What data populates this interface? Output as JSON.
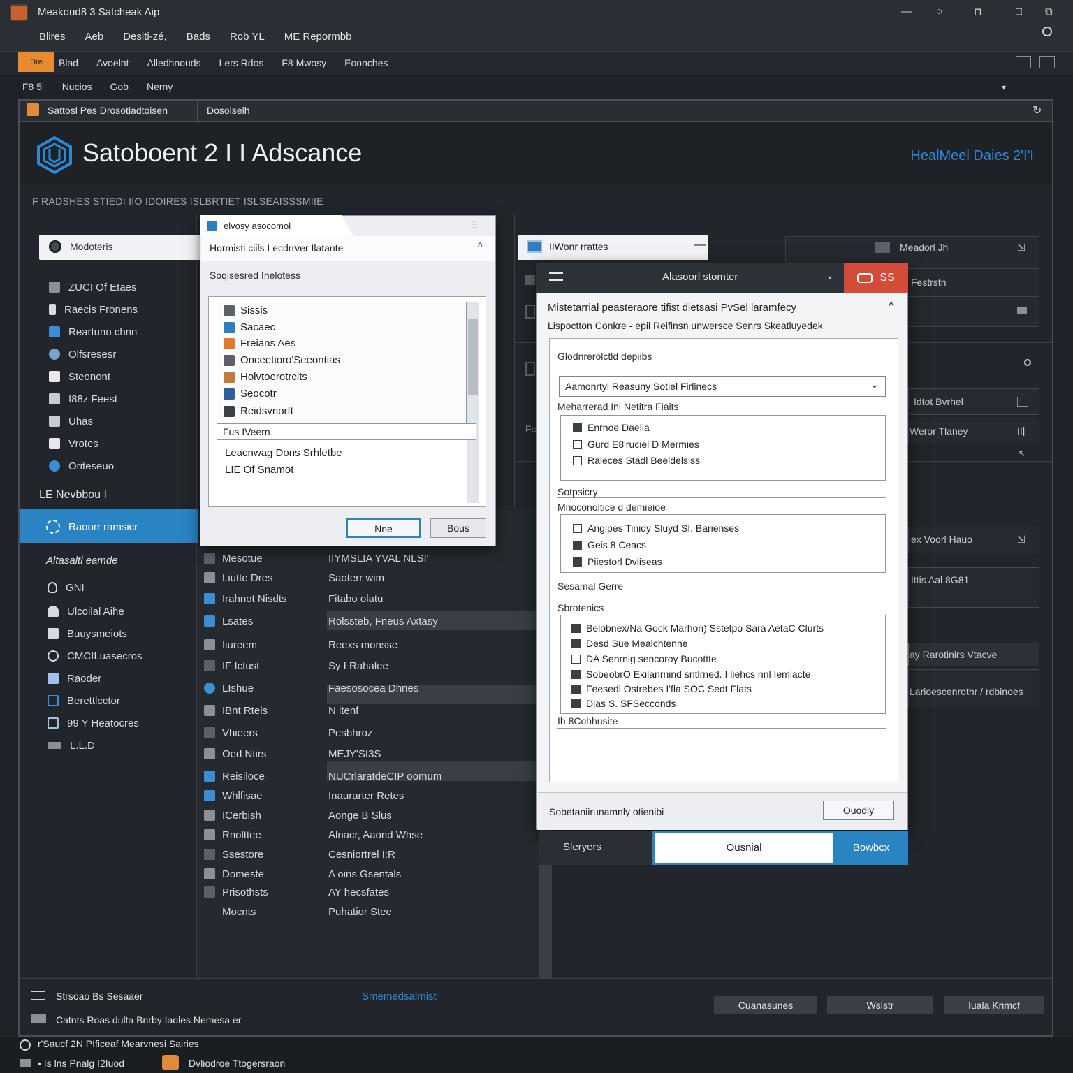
{
  "window": {
    "title": "Meakoud8 3 Satcheak Aip",
    "controls": [
      "—",
      "○",
      "⊓",
      "□",
      "⧉"
    ]
  },
  "menu": [
    "Blires",
    "Aeb",
    "Desiti-zé,",
    "Bads",
    "Rob YL",
    "ME Repormbb"
  ],
  "toolbar": {
    "badge": "Dre",
    "items": [
      "Blad",
      "Avoelnt",
      "Alledhnouds",
      "Lers Rdos",
      "F8 Mwosy",
      "Eoonches"
    ]
  },
  "tabs2": [
    "F8 5'",
    "Nucios",
    "Gob",
    "Nerny"
  ],
  "doc_tabs": [
    "Sattosl Pes Drosotiadtoisen",
    "Dosoiselh"
  ],
  "header": {
    "title": "Satoboent 2 I I Adscance",
    "accent": "HealMeel Daies 2'I'I",
    "subhead": "F RADSHES STIEDI   IIO IDOIRES   ISLBRTIET ISLSEAISSSMIIE"
  },
  "sidebar": {
    "search_label": "Modoteris",
    "items": [
      {
        "label": "ZUCI Of Etaes",
        "icon": "database-icon",
        "color": "#8b9098"
      },
      {
        "label": "Raecis Fronens",
        "icon": "pointer-icon",
        "color": "#d6dae0"
      },
      {
        "label": "Reartuno chnn",
        "icon": "chart-icon",
        "color": "#3a8ed4"
      },
      {
        "label": "Olfsresesr",
        "icon": "globe-icon",
        "color": "#7aa3c9"
      },
      {
        "label": "Steonont",
        "icon": "document-icon",
        "color": "#e6e8eb"
      },
      {
        "label": "I88z Feest",
        "icon": "image-icon",
        "color": "#c8ccd2"
      },
      {
        "label": "Uhas",
        "icon": "chart-bar-icon",
        "color": "#c8ccd2"
      },
      {
        "label": "Vrotes",
        "icon": "video-icon",
        "color": "#e6e8eb"
      },
      {
        "label": "Oriteseuo",
        "icon": "pie-icon",
        "color": "#3a8ed4"
      }
    ],
    "section": "LE Nevbbou I",
    "active_label": "Raoorr ramsicr",
    "section2": "Altasaltl eamde",
    "items2": [
      {
        "label": "GNI",
        "icon": "bulb-icon"
      },
      {
        "label": "Ulcoilal Aihe",
        "icon": "user-icon"
      },
      {
        "label": "Buuysmeiots",
        "icon": "folder-icon"
      },
      {
        "label": "CMCILuasecros",
        "icon": "link-icon"
      },
      {
        "label": "Raoder",
        "icon": "window-icon"
      },
      {
        "label": "Berettlcctor",
        "icon": "panel-icon"
      },
      {
        "label": "99 Y Heatocres",
        "icon": "grid-icon"
      },
      {
        "label": "L.L.Ð",
        "icon": "tag-icon"
      }
    ]
  },
  "dialog1": {
    "tab": "elvosy asocomol",
    "tab_ctl": "= Ξ",
    "head": "Hormisti ciils Lecdrrver Ilatante",
    "sub": "Soqisesred Inelotess",
    "list": [
      {
        "label": "Sissis",
        "color": "#5c6169"
      },
      {
        "label": "Sacaec",
        "color": "#2f7fc0"
      },
      {
        "label": "Freians Aes",
        "color": "#e07a2e"
      },
      {
        "label": "Onceetioro'Seeontias",
        "color": "#5c6169"
      },
      {
        "label": "Holvtoerotrcits",
        "color": "#c27a3a"
      },
      {
        "label": "Seocotr",
        "color": "#2f5f9a"
      },
      {
        "label": "Reidsvnorft",
        "color": "#3c4148"
      }
    ],
    "field": "Fus IVeern",
    "text1": "Leacnwag Dons Srhletbe",
    "text2": "LIE Of Snamot",
    "btn_primary": "Nne",
    "btn_secondary": "Bous"
  },
  "middle": {
    "rows": [
      {
        "k": "Mesotue",
        "v": "IIYMSLIA YVAL NLSI'"
      },
      {
        "k": "Liutte Dres",
        "v": "Saoterr wim"
      },
      {
        "k": "Irahnot Nisdts",
        "v": "Fitabo olatu"
      },
      {
        "k": "Lsates",
        "v": "Rolssteb, Fneus Axtasy"
      },
      {
        "k": "Iiureem",
        "v": "Reexs monsse"
      },
      {
        "k": "IF Ictust",
        "v": "Sy I Rahalee"
      },
      {
        "k": "LIshue",
        "v": "Faesosocea Dhnes"
      },
      {
        "k": "IBnt Rtels",
        "v": "N ltenf"
      },
      {
        "k": "Vhieers",
        "v": "Pesbhroz"
      },
      {
        "k": "Oed Ntirs",
        "v": "MEJY'SI3S"
      },
      {
        "k": "Reisiloce",
        "v": "NUCrlaratdeCIP oomum"
      },
      {
        "k": "Whlfisae",
        "v": "Inaurarter Retes"
      },
      {
        "k": "ICerbish",
        "v": "Aonge B Slus"
      },
      {
        "k": "Rnolttee",
        "v": "Alnacr, Aaond Whse"
      },
      {
        "k": "Ssestore",
        "v": "Cesniortrel I:R"
      },
      {
        "k": "Domeste",
        "v": "A oins Gsentals"
      },
      {
        "k": "Prisothsts",
        "v": "AY hecsfates"
      },
      {
        "k": "Mocnts",
        "v": "Puhatior Stee"
      }
    ]
  },
  "right": {
    "search_label": "IIWonr rrattes",
    "card_rows": [
      "Meadorl Jh",
      "Festrstn",
      ""
    ],
    "rows": [
      "Idtot Bvrhel",
      "Weror Tlaney",
      "ex Voorl Hauo",
      "Ittis Aal 8G81",
      "ay Rarotinirs Vtacve",
      "Larioescenrothr / rdbinoes"
    ]
  },
  "dialog2": {
    "title": "Alasoorl stomter",
    "red_label": "SS",
    "desc1": "Mistetarrial peasteraore tifist dietsasi PvSel laramfecy",
    "desc2": "Lispoctton Conkre - epil Reifinsn unwersce Senrs Skeatluyedek",
    "sect1": "Glodnrerolctld depiibs",
    "select": "Aamonrtyl Reasuny Sotiel Firlinecs",
    "sect2": "Meharrerad Ini Netitra Fiaits",
    "group1": [
      {
        "label": "Enrnoe Daelia",
        "on": true
      },
      {
        "label": "Gurd E8'ruciel D Mermies",
        "on": false
      },
      {
        "label": "Raleces Stadl Beeldelsiss",
        "on": false
      }
    ],
    "sect3": "Sotpsicry",
    "sect4": "Mnoconoltice d demieioe",
    "group2": [
      {
        "label": "Angipes Tinidy Sluyd SI. Barienses",
        "on": false
      },
      {
        "label": "Geis 8 Ceacs",
        "on": true
      },
      {
        "label": "Piiestorl Dvliseas",
        "on": true
      }
    ],
    "sect5": "Sesamal Gerre",
    "sect6": "Sbrotenics",
    "group3": [
      {
        "label": "Belobnex/Na Gock Marhon) Sstetpo Sara AetaC Clurts",
        "on": true
      },
      {
        "label": "Desd Sue Mealchtenne",
        "on": true
      },
      {
        "label": "DA Senrnig sencoroy Bucottte",
        "on": false
      },
      {
        "label": "SobeobrO Ekilanrnind sntlrned. I liehcs nnl Iemlacte",
        "on": true
      },
      {
        "label": "Feesedl Ostrebes I'fla SOC Sedt Flats",
        "on": true
      },
      {
        "label": "Dias S. SFSecconds",
        "on": true
      }
    ],
    "sect7": "Ih 8Cohhusite",
    "foot_label": "Sobetaniirunamnly otienibi",
    "foot_btn": "Ouodiy",
    "bottom_left": "Sleryers",
    "bottom_mid": "Ousnial",
    "bottom_right": "Bowbcx"
  },
  "bottom": {
    "line1": "Strsoao Bs Sesaaer",
    "line2": "Catnts Roas dulta Bnrby Iaoles Nemesa er",
    "center": "Smemedsalmist",
    "btn1": "Cuanasunes",
    "btn2": "Wslstr",
    "btn3": "Iuala Krimcf"
  },
  "status": {
    "line1": "r'Saucf   2N PIficeaf Mearvnesi Sairies",
    "line2": "• Is lns Pnalg I2Iuod",
    "line3": "Dvliodroe Ttogersraon"
  }
}
